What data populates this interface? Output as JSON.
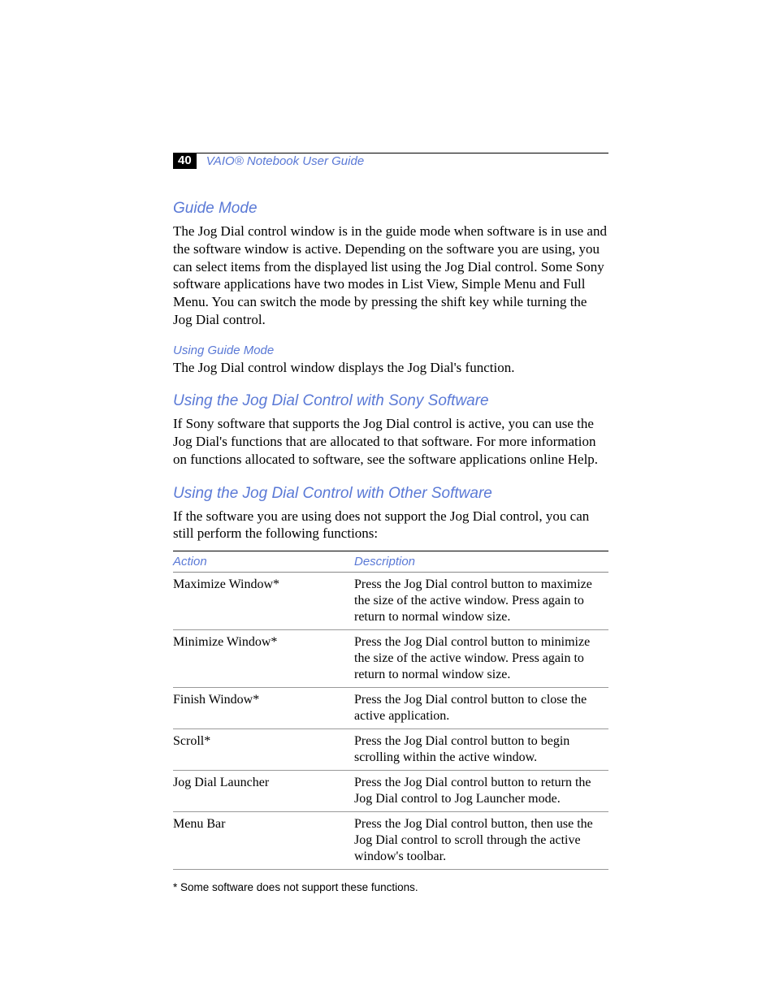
{
  "header": {
    "page_number": "40",
    "guide_title": "VAIO® Notebook User Guide"
  },
  "sections": {
    "guide_mode": {
      "heading": "Guide Mode",
      "body": "The Jog Dial control window is in the guide mode when software is in use and the software window is active. Depending on the software you are using, you can select items from the displayed list using the Jog Dial control. Some Sony software applications have two modes in List View, Simple Menu and Full Menu. You can switch the mode by pressing the shift key while turning the Jog Dial control.",
      "sub_heading": "Using Guide Mode",
      "sub_body": "The Jog Dial control window displays the Jog Dial's function."
    },
    "sony_software": {
      "heading": "Using the Jog Dial Control with Sony Software",
      "body": "If Sony software that supports the Jog Dial control is active, you can use the Jog Dial's functions that are allocated to that software. For more information on functions allocated to software, see the software applications online Help."
    },
    "other_software": {
      "heading": "Using the Jog Dial Control with Other Software",
      "body": "If the software you are using does not support the Jog Dial control, you can still perform the following functions:"
    }
  },
  "table": {
    "columns": {
      "action": "Action",
      "description": "Description"
    },
    "rows": [
      {
        "action": "Maximize Window*",
        "description": "Press the Jog Dial control button to maximize the size of the active window. Press again to return to normal window size."
      },
      {
        "action": "Minimize Window*",
        "description": "Press the Jog Dial control button to minimize the size of the active window. Press again to return to normal window size."
      },
      {
        "action": "Finish Window*",
        "description": "Press the Jog Dial control button to close the active application."
      },
      {
        "action": "Scroll*",
        "description": "Press the Jog Dial control button to begin scrolling within the active window."
      },
      {
        "action": "Jog Dial Launcher",
        "description": "Press the Jog Dial control button to return the Jog Dial control to Jog Launcher mode."
      },
      {
        "action": "Menu Bar",
        "description": "Press the Jog Dial control button, then use the Jog Dial control to scroll through the active window's toolbar."
      }
    ]
  },
  "footnote": "*  Some software does not support these functions."
}
